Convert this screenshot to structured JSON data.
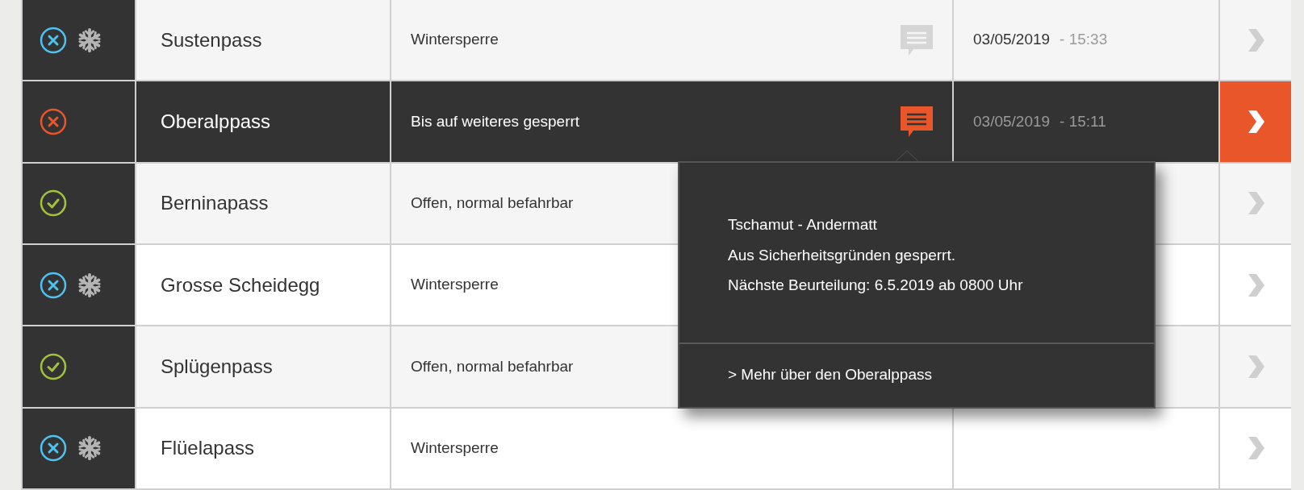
{
  "rows": [
    {
      "kind": "closed",
      "winter": true,
      "name": "Sustenpass",
      "message": "Wintersperre",
      "comment": true,
      "date": "03/05/2019",
      "time": "- 15:33",
      "selected": false
    },
    {
      "kind": "blocked",
      "winter": false,
      "name": "Oberalppass",
      "message": "Bis auf weiteres gesperrt",
      "comment": true,
      "date": "03/05/2019",
      "time": "- 15:11",
      "selected": true
    },
    {
      "kind": "open",
      "winter": false,
      "name": "Berninapass",
      "message": "Offen, normal befahrbar",
      "comment": false,
      "selected": false
    },
    {
      "kind": "closed",
      "winter": true,
      "name": "Grosse Scheidegg",
      "message": "Wintersperre",
      "comment": false,
      "selected": false
    },
    {
      "kind": "open",
      "winter": false,
      "name": "Splügenpass",
      "message": "Offen, normal befahrbar",
      "comment": false,
      "selected": false
    },
    {
      "kind": "closed",
      "winter": true,
      "name": "Flüelapass",
      "message": "Wintersperre",
      "comment": false,
      "selected": false
    }
  ],
  "popover": {
    "lines": [
      "Tschamut - Andermatt",
      "Aus Sicherheitsgründen gesperrt.",
      "Nächste Beurteilung: 6.5.2019 ab 0800 Uhr"
    ],
    "link": "> Mehr über den Oberalppass"
  }
}
